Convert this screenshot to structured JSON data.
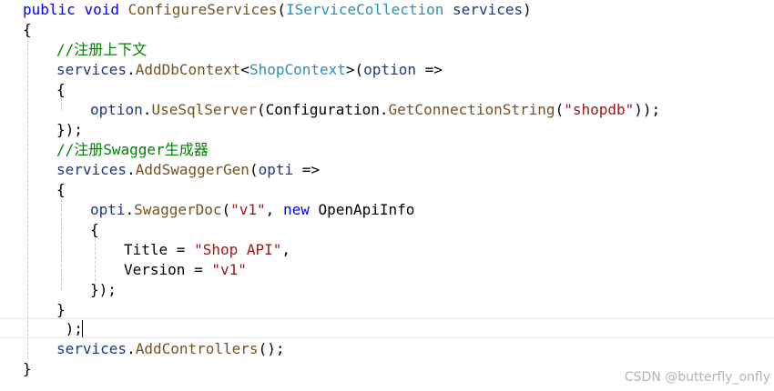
{
  "code": {
    "l01": {
      "kw1": "public",
      "kw2": "void",
      "method": "ConfigureServices",
      "p1": "(",
      "type": "IServiceCollection",
      "param": "services",
      "p2": ")"
    },
    "l02": {
      "text": "{"
    },
    "l03": {
      "comment": "//注册上下文"
    },
    "l04": {
      "obj": "services",
      "p1": ".",
      "method": "AddDbContext",
      "p2": "<",
      "type": "ShopContext",
      "p3": ">(",
      "param": "option",
      "p4": " =>"
    },
    "l05": {
      "text": "{"
    },
    "l06": {
      "obj": "option",
      "p1": ".",
      "method": "UseSqlServer",
      "p2": "(Configuration.",
      "method2": "GetConnectionString",
      "p3": "(",
      "str": "\"shopdb\"",
      "p4": "));"
    },
    "l07": {
      "text": "});"
    },
    "l08": {
      "comment": "//注册Swagger生成器"
    },
    "l09": {
      "obj": "services",
      "p1": ".",
      "method": "AddSwaggerGen",
      "p2": "(",
      "param": "opti",
      "p3": " =>"
    },
    "l10": {
      "text": "{"
    },
    "l11": {
      "obj": "opti",
      "p1": ".",
      "method": "SwaggerDoc",
      "p2": "(",
      "str": "\"v1\"",
      "p3": ", ",
      "kw": "new",
      "p4": " OpenApiInfo"
    },
    "l12": {
      "text": "{"
    },
    "l13": {
      "prop": "Title",
      "p1": " = ",
      "str": "\"Shop API\"",
      "p2": ","
    },
    "l14": {
      "prop": "Version",
      "p1": " = ",
      "str": "\"v1\""
    },
    "l15": {
      "text": "});"
    },
    "l16": {
      "text": "}"
    },
    "l17": {
      "text": " );"
    },
    "l18": {
      "obj": "services",
      "p1": ".",
      "method": "AddControllers",
      "p2": "();"
    },
    "l19": {
      "text": "}"
    }
  },
  "watermark": "CSDN @butterfly_onfly",
  "colors": {
    "keyword": "#0000ff",
    "identifier": "#1f377f",
    "method": "#74531f",
    "type": "#2b91af",
    "string": "#a31515",
    "comment": "#008000"
  }
}
